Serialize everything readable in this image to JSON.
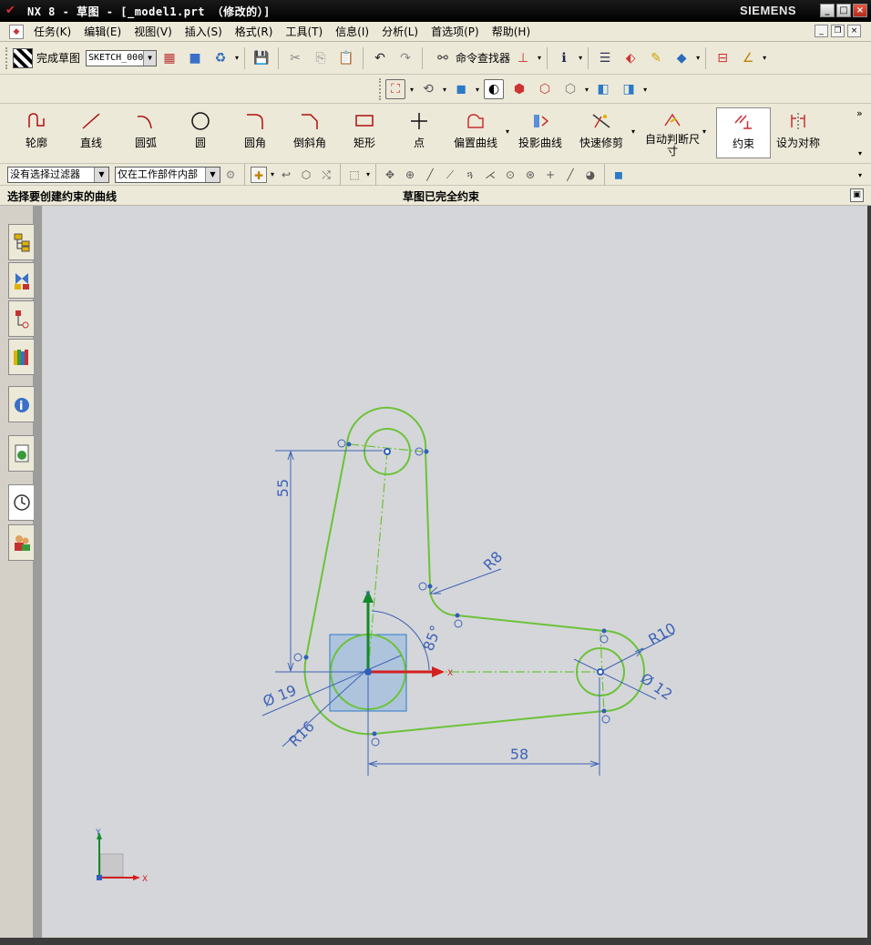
{
  "window": {
    "title": "NX 8 - 草图 - [_model1.prt （修改的）]",
    "brand": "SIEMENS",
    "controls": {
      "minimize": "_",
      "maximize": "□",
      "close": "×"
    }
  },
  "menubar": {
    "items": [
      "任务(K)",
      "编辑(E)",
      "视图(V)",
      "插入(S)",
      "格式(R)",
      "工具(T)",
      "信息(I)",
      "分析(L)",
      "首选项(P)",
      "帮助(H)"
    ]
  },
  "toolbar_top": {
    "finish_sketch_label": "完成草图",
    "sketch_name": "SKETCH_000",
    "command_finder_label": "命令查找器"
  },
  "sketch_tools": [
    {
      "label": "轮廓",
      "icon": "profile-icon"
    },
    {
      "label": "直线",
      "icon": "line-icon"
    },
    {
      "label": "圆弧",
      "icon": "arc-icon"
    },
    {
      "label": "圆",
      "icon": "circle-icon"
    },
    {
      "label": "圆角",
      "icon": "fillet-icon"
    },
    {
      "label": "倒斜角",
      "icon": "chamfer-icon"
    },
    {
      "label": "矩形",
      "icon": "rectangle-icon"
    },
    {
      "label": "点",
      "icon": "point-icon"
    },
    {
      "label": "偏置曲线",
      "icon": "offset-curve-icon"
    },
    {
      "label": "投影曲线",
      "icon": "project-curve-icon"
    },
    {
      "label": "快速修剪",
      "icon": "quick-trim-icon"
    },
    {
      "label": "自动判断尺寸",
      "icon": "inferred-dimension-icon"
    },
    {
      "label": "约束",
      "icon": "constraint-icon"
    },
    {
      "label": "设为对称",
      "icon": "make-symmetric-icon"
    }
  ],
  "selection_bar": {
    "filter": "没有选择过滤器",
    "scope": "仅在工作部件内部"
  },
  "cue_line": "选择要创建约束的曲线",
  "status_line": "草图已完全约束",
  "sketch": {
    "dimensions": {
      "vertical_55": "55",
      "horizontal_58": "58",
      "angle_85": "85°",
      "radius_8": "R8",
      "radius_10": "R10",
      "radius_16": "R16",
      "diameter_12": "Ø 12",
      "diameter_19": "Ø 19"
    },
    "axis_labels": {
      "x": "X",
      "y": "Y"
    },
    "colors": {
      "curve": "#6cc23a",
      "dimension": "#3e63b8",
      "axis_x": "#d42020",
      "axis_y": "#138a2a",
      "csys_face": "#5a9ee0"
    }
  },
  "triad": {
    "x": "X",
    "y": "Y"
  },
  "resource_bar": [
    "assembly-navigator-icon",
    "constraint-navigator-icon",
    "part-navigator-icon",
    "reuse-library-icon",
    "internet-explorer-icon",
    "history-icon",
    "roles-icon",
    "system-materials-icon"
  ]
}
